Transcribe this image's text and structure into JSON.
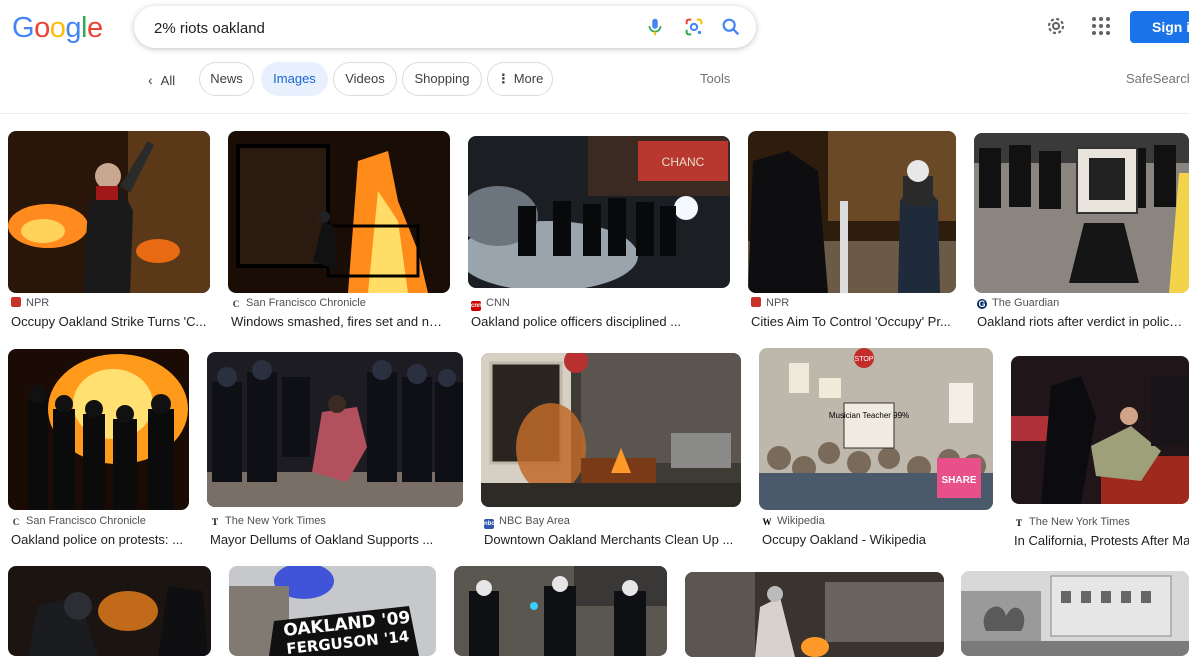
{
  "header": {
    "search_value": "2% riots oakland",
    "sign_in_label": "Sign in"
  },
  "nav": {
    "back_label": "All",
    "tabs": [
      {
        "label": "News"
      },
      {
        "label": "Images",
        "active": true
      },
      {
        "label": "Videos"
      },
      {
        "label": "Shopping"
      },
      {
        "label": "More"
      }
    ],
    "tools_label": "Tools",
    "safesearch_label": "SafeSearch"
  },
  "results": [
    {
      "source": "NPR",
      "title": "Occupy Oakland Strike Turns 'C..."
    },
    {
      "source": "San Francisco Chronicle",
      "title": "Windows smashed, fires set and no..."
    },
    {
      "source": "CNN",
      "title": "Oakland police officers disciplined ..."
    },
    {
      "source": "NPR",
      "title": "Cities Aim To Control 'Occupy' Pr..."
    },
    {
      "source": "The Guardian",
      "title": "Oakland riots after verdict in police ..."
    },
    {
      "source": "San Francisco Chronicle",
      "title": "Oakland police on protests: ..."
    },
    {
      "source": "The New York Times",
      "title": "Mayor Dellums of Oakland Supports ..."
    },
    {
      "source": "NBC Bay Area",
      "title": "Downtown Oakland Merchants Clean Up ..."
    },
    {
      "source": "Wikipedia",
      "title": "Occupy Oakland - Wikipedia"
    },
    {
      "source": "The New York Times",
      "title": "In California, Protests After Ma"
    }
  ],
  "image_text": {
    "oakland_sign_line1": "OAKLAND '09",
    "oakland_sign_line2": "FERGUSON '14",
    "chance_sign": "CHANC",
    "share_sign": "SHARE",
    "stop_sign": "STOP",
    "musician_sign": "Musician Teacher 99%"
  },
  "colors": {
    "accent_blue": "#1a73e8",
    "active_chip_bg": "#e8f0fe",
    "active_chip_text": "#1967d2"
  }
}
